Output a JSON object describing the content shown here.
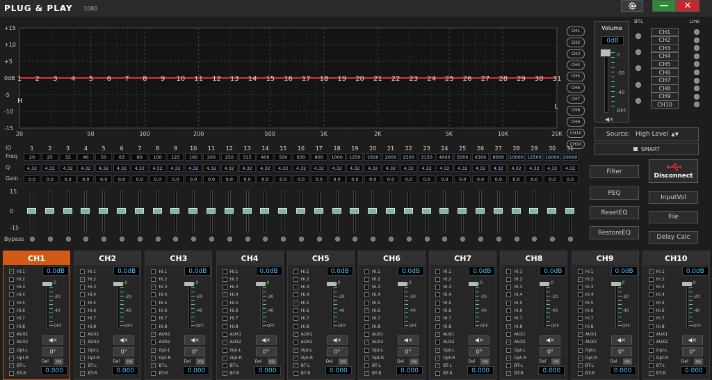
{
  "app": {
    "title": "PLUG & PLAY",
    "version": "1080"
  },
  "window": {
    "settings_icon": "gear-icon",
    "minimize_label": "—",
    "close_label": "✕"
  },
  "graph": {
    "y_ticks": [
      "+15",
      "+10",
      "+5",
      "0dB",
      "-5",
      "-10",
      "-15"
    ],
    "x_ticks": [
      "20",
      "50",
      "100",
      "200",
      "500",
      "1K",
      "2K",
      "5K",
      "10K",
      "20K"
    ],
    "band_numbers": [
      "1",
      "2",
      "3",
      "4",
      "5",
      "6",
      "7",
      "8",
      "9",
      "10",
      "11",
      "12",
      "13",
      "14",
      "15",
      "16",
      "17",
      "18",
      "19",
      "20",
      "21",
      "22",
      "23",
      "24",
      "25",
      "26",
      "27",
      "28",
      "29",
      "30",
      "31"
    ],
    "h_marker": "H",
    "l_marker": "L",
    "curve_color": "#e03030"
  },
  "channel_tags": [
    "CH1",
    "CH2",
    "CH3",
    "CH4",
    "CH5",
    "CH6",
    "CH7",
    "CH8",
    "CH9",
    "CH10"
  ],
  "bands": {
    "labels": {
      "id": "ID",
      "freq": "Freq",
      "q": "Q",
      "gain": "Gain"
    },
    "freq": [
      "20",
      "25",
      "32",
      "40",
      "50",
      "63",
      "80",
      "100",
      "125",
      "160",
      "200",
      "250",
      "315",
      "400",
      "500",
      "630",
      "800",
      "1000",
      "1250",
      "1600",
      "2000",
      "2500",
      "3150",
      "4000",
      "5000",
      "6300",
      "8000",
      "10000",
      "12500",
      "16000",
      "20000"
    ],
    "q": "4.32",
    "gain": "0.0"
  },
  "sliders": {
    "scale": [
      "15",
      "0",
      "-15"
    ],
    "bypass_label": "Bypass",
    "gain_db": 0
  },
  "volume": {
    "label": "Volume",
    "value": "0dB",
    "scale": [
      "0",
      "-20",
      "-40",
      "OFF"
    ],
    "mute_icon": "speaker-mute-icon"
  },
  "routing": {
    "btl_label": "BTL",
    "link_label": "Link",
    "channels": [
      "CH1",
      "CH2",
      "CH3",
      "CH4",
      "CH5",
      "CH6",
      "CH7",
      "CH8",
      "CH9",
      "CH10"
    ]
  },
  "source": {
    "label": "Source:",
    "value": "High Level"
  },
  "smart_label": "SMART",
  "buttons": {
    "filter": "Filter",
    "peq": "PEQ",
    "reset_eq": "ResetEQ",
    "restore_eq": "RestoreEQ",
    "disconnect": "Disconnect",
    "input_vol": "InputVol",
    "file": "File",
    "delay_calc": "Delay Calc"
  },
  "usb_icon": "usb-icon",
  "strips": [
    {
      "name": "CH1",
      "db": "0.0dB",
      "phase": "0°",
      "delay": "0.000",
      "checked": [
        0,
        8,
        10,
        11,
        12
      ]
    },
    {
      "name": "CH2",
      "db": "0.0dB",
      "phase": "0°",
      "delay": "0.000",
      "checked": [
        1,
        9,
        11,
        13
      ]
    },
    {
      "name": "CH3",
      "db": "0.0dB",
      "phase": "0°",
      "delay": "0.000",
      "checked": [
        2,
        8,
        10,
        11,
        12
      ]
    },
    {
      "name": "CH4",
      "db": "0.0dB",
      "phase": "0°",
      "delay": "0.000",
      "checked": [
        3,
        9,
        11,
        13
      ]
    },
    {
      "name": "CH5",
      "db": "0.0dB",
      "phase": "0°",
      "delay": "0.000",
      "checked": [
        4,
        8,
        10,
        11,
        12
      ]
    },
    {
      "name": "CH6",
      "db": "0.0dB",
      "phase": "0°",
      "delay": "0.000",
      "checked": [
        5,
        9,
        11,
        13
      ]
    },
    {
      "name": "CH7",
      "db": "0.0dB",
      "phase": "0°",
      "delay": "0.000",
      "checked": [
        6,
        8,
        10,
        11,
        12
      ]
    },
    {
      "name": "CH8",
      "db": "0.0dB",
      "phase": "0°",
      "delay": "0.000",
      "checked": [
        7,
        9,
        11,
        13
      ]
    },
    {
      "name": "CH9",
      "db": "0.0dB",
      "phase": "0°",
      "delay": "0.000",
      "checked": [
        1,
        8,
        10,
        11,
        12
      ]
    },
    {
      "name": "CH10",
      "db": "0.0dB",
      "phase": "0°",
      "delay": "0.000",
      "checked": [
        0,
        9,
        11,
        13
      ]
    }
  ],
  "strip_inputs": [
    "Hi.1",
    "Hi.2",
    "Hi.3",
    "Hi.4",
    "Hi.5",
    "Hi.6",
    "Hi.7",
    "Hi.8",
    "AUX1",
    "AUX2",
    "Opt-L",
    "Opt-R",
    "BT-L",
    "BT-R"
  ],
  "strip_scale": [
    "0",
    "-20",
    "-40",
    "OFF"
  ],
  "strip_mute_label": "🔇",
  "strip_del_label": "Del",
  "strip_ms_label": "ms",
  "colors": {
    "accent": "#d05a16",
    "value_text": "#4fc3ff",
    "check": "#4fd06b"
  }
}
